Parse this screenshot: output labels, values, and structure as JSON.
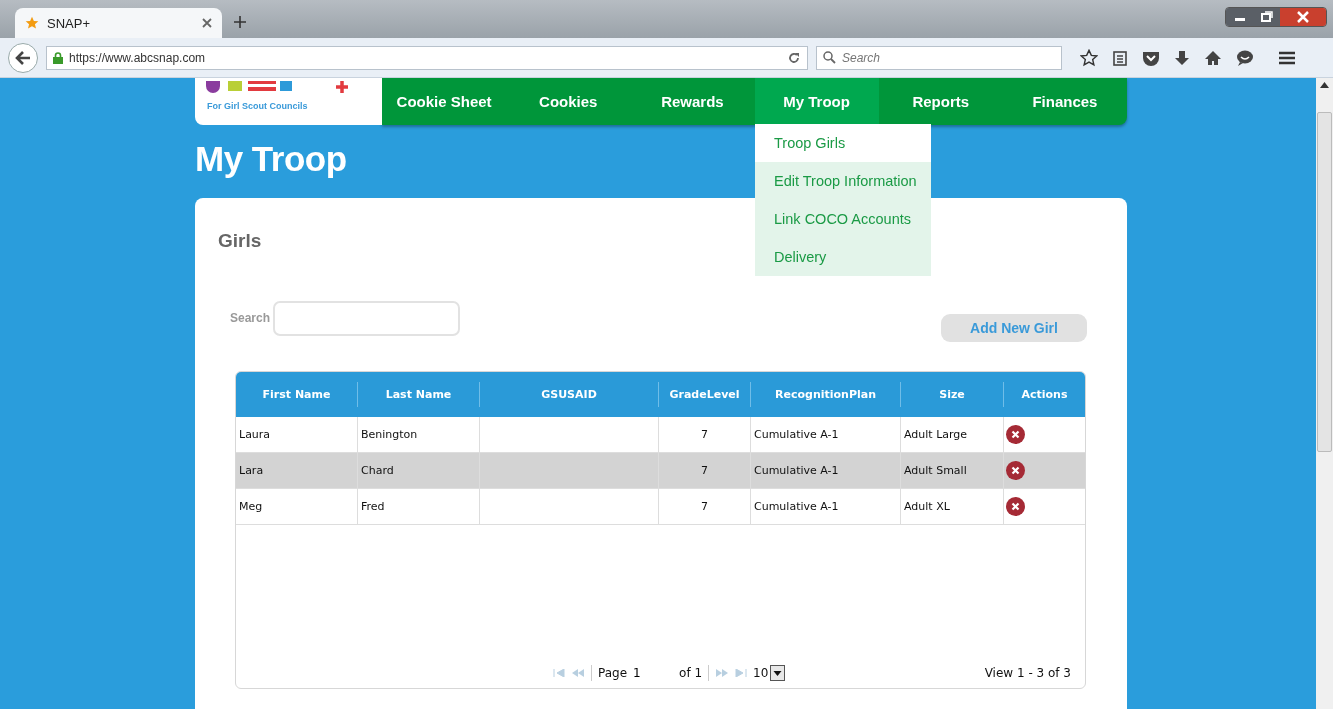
{
  "browser": {
    "tab_title": "SNAP+",
    "url": "https://www.abcsnap.com",
    "search_placeholder": "Search"
  },
  "site": {
    "logo_tagline": "For Girl Scout Councils",
    "nav": [
      {
        "label": "Cookie Sheet",
        "selected": false
      },
      {
        "label": "Cookies",
        "selected": false
      },
      {
        "label": "Rewards",
        "selected": false
      },
      {
        "label": "My Troop",
        "selected": true
      },
      {
        "label": "Reports",
        "selected": false
      },
      {
        "label": "Finances",
        "selected": false
      }
    ],
    "menu": [
      {
        "label": "Troop Girls",
        "highlighted": true
      },
      {
        "label": "Edit Troop Information",
        "highlighted": false
      },
      {
        "label": "Link COCO Accounts",
        "highlighted": false
      },
      {
        "label": "Delivery",
        "highlighted": false
      }
    ]
  },
  "page_title": "My Troop",
  "panel": {
    "title": "Girls",
    "search_label": "Search",
    "add_button": "Add New Girl"
  },
  "table": {
    "columns": [
      "First Name",
      "Last Name",
      "GSUSAID",
      "GradeLevel",
      "RecognitionPlan",
      "Size",
      "Actions"
    ],
    "rows": [
      {
        "cells": [
          "Laura",
          "Benington",
          "",
          "7",
          "Cumulative A-1",
          "Adult Large"
        ],
        "selected": false
      },
      {
        "cells": [
          "Lara",
          "Chard",
          "",
          "7",
          "Cumulative A-1",
          "Adult Small"
        ],
        "selected": true
      },
      {
        "cells": [
          "Meg",
          "Fred",
          "",
          "7",
          "Cumulative A-1",
          "Adult XL"
        ],
        "selected": false
      }
    ]
  },
  "pager": {
    "page_label": "Page",
    "page_value": "1",
    "of_label": "of 1",
    "page_size": "10",
    "view_info": "View 1 - 3 of 3"
  }
}
